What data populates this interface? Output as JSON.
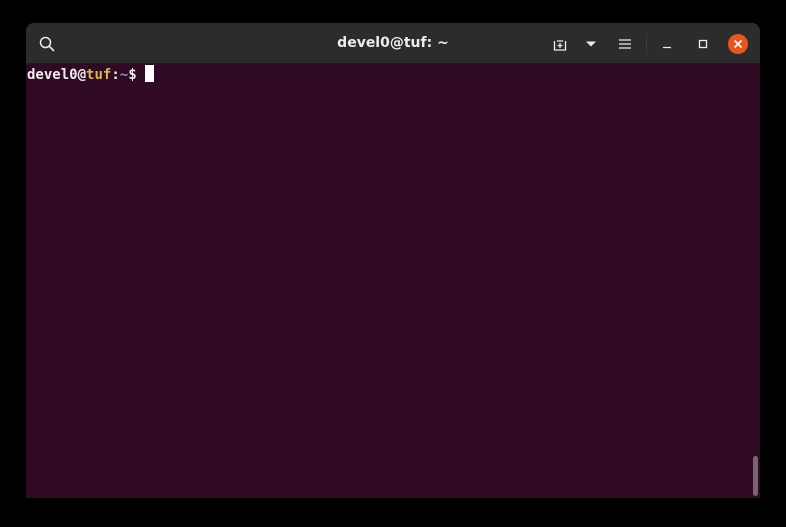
{
  "window": {
    "title": "devel0@tuf: ~"
  },
  "titlebar": {
    "search_icon": "search-icon",
    "new_tab_icon": "new-tab-icon",
    "dropdown_icon": "chevron-down-icon",
    "menu_icon": "hamburger-menu-icon",
    "minimize_icon": "minimize-icon",
    "maximize_icon": "maximize-icon",
    "close_icon": "close-icon"
  },
  "terminal": {
    "prompt": {
      "user": "devel0",
      "at": "@",
      "host": "tuf",
      "colon": ":",
      "path": "~",
      "symbol": "$ "
    }
  },
  "colors": {
    "terminal_background": "#300a24",
    "titlebar_background": "#2c2c2c",
    "close_button": "#e95420",
    "host_color": "#d6b84c",
    "path_color": "#8f8fcf"
  }
}
